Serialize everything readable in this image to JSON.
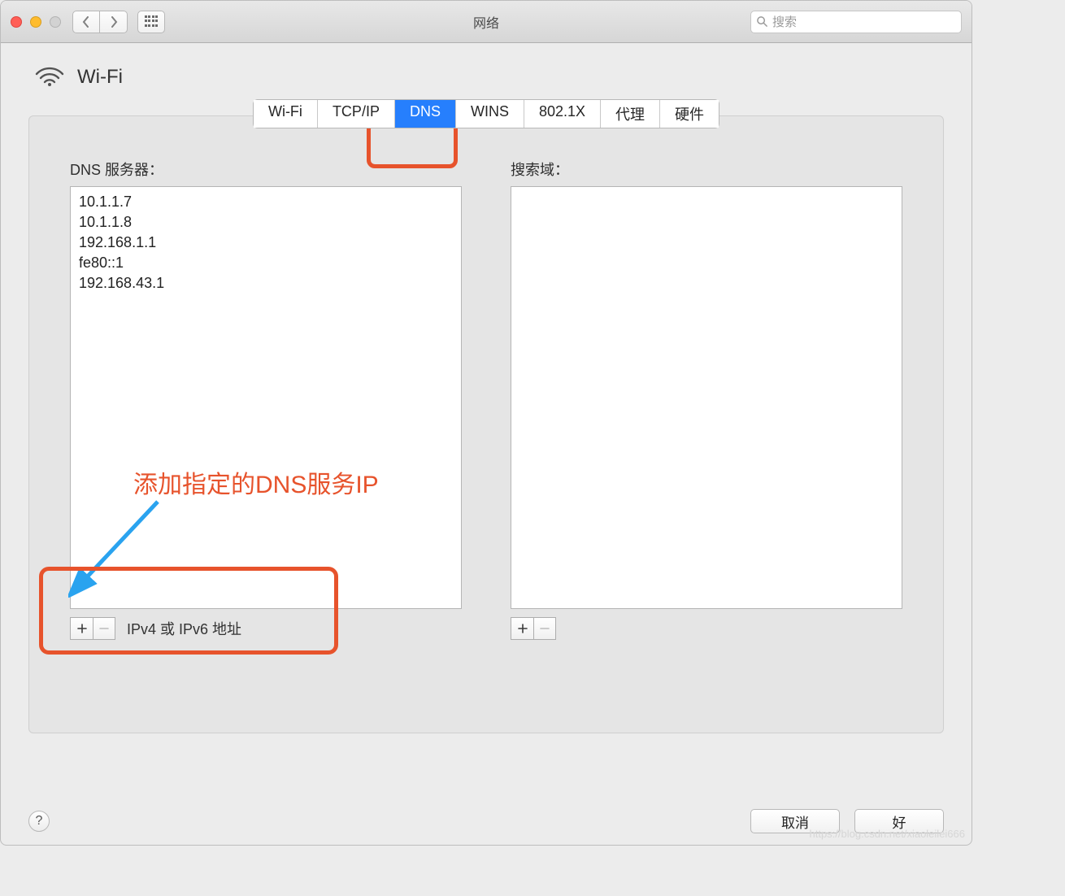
{
  "window": {
    "title": "网络"
  },
  "search": {
    "placeholder": "搜索"
  },
  "pane": {
    "title": "Wi-Fi"
  },
  "tabs": {
    "items": [
      "Wi-Fi",
      "TCP/IP",
      "DNS",
      "WINS",
      "802.1X",
      "代理",
      "硬件"
    ],
    "active_index": 2
  },
  "dns": {
    "label": "DNS 服务器：",
    "servers": [
      "10.1.1.7",
      "10.1.1.8",
      "192.168.1.1",
      "fe80::1",
      "192.168.43.1"
    ],
    "hint": "IPv4 或 IPv6 地址"
  },
  "search_domains": {
    "label": "搜索域：",
    "items": []
  },
  "buttons": {
    "cancel": "取消",
    "ok": "好"
  },
  "icons": {
    "help": "?"
  },
  "annotations": {
    "add_dns": "添加指定的DNS服务IP"
  },
  "watermark": "https://blog.csdn.net/xiaoleilei666"
}
